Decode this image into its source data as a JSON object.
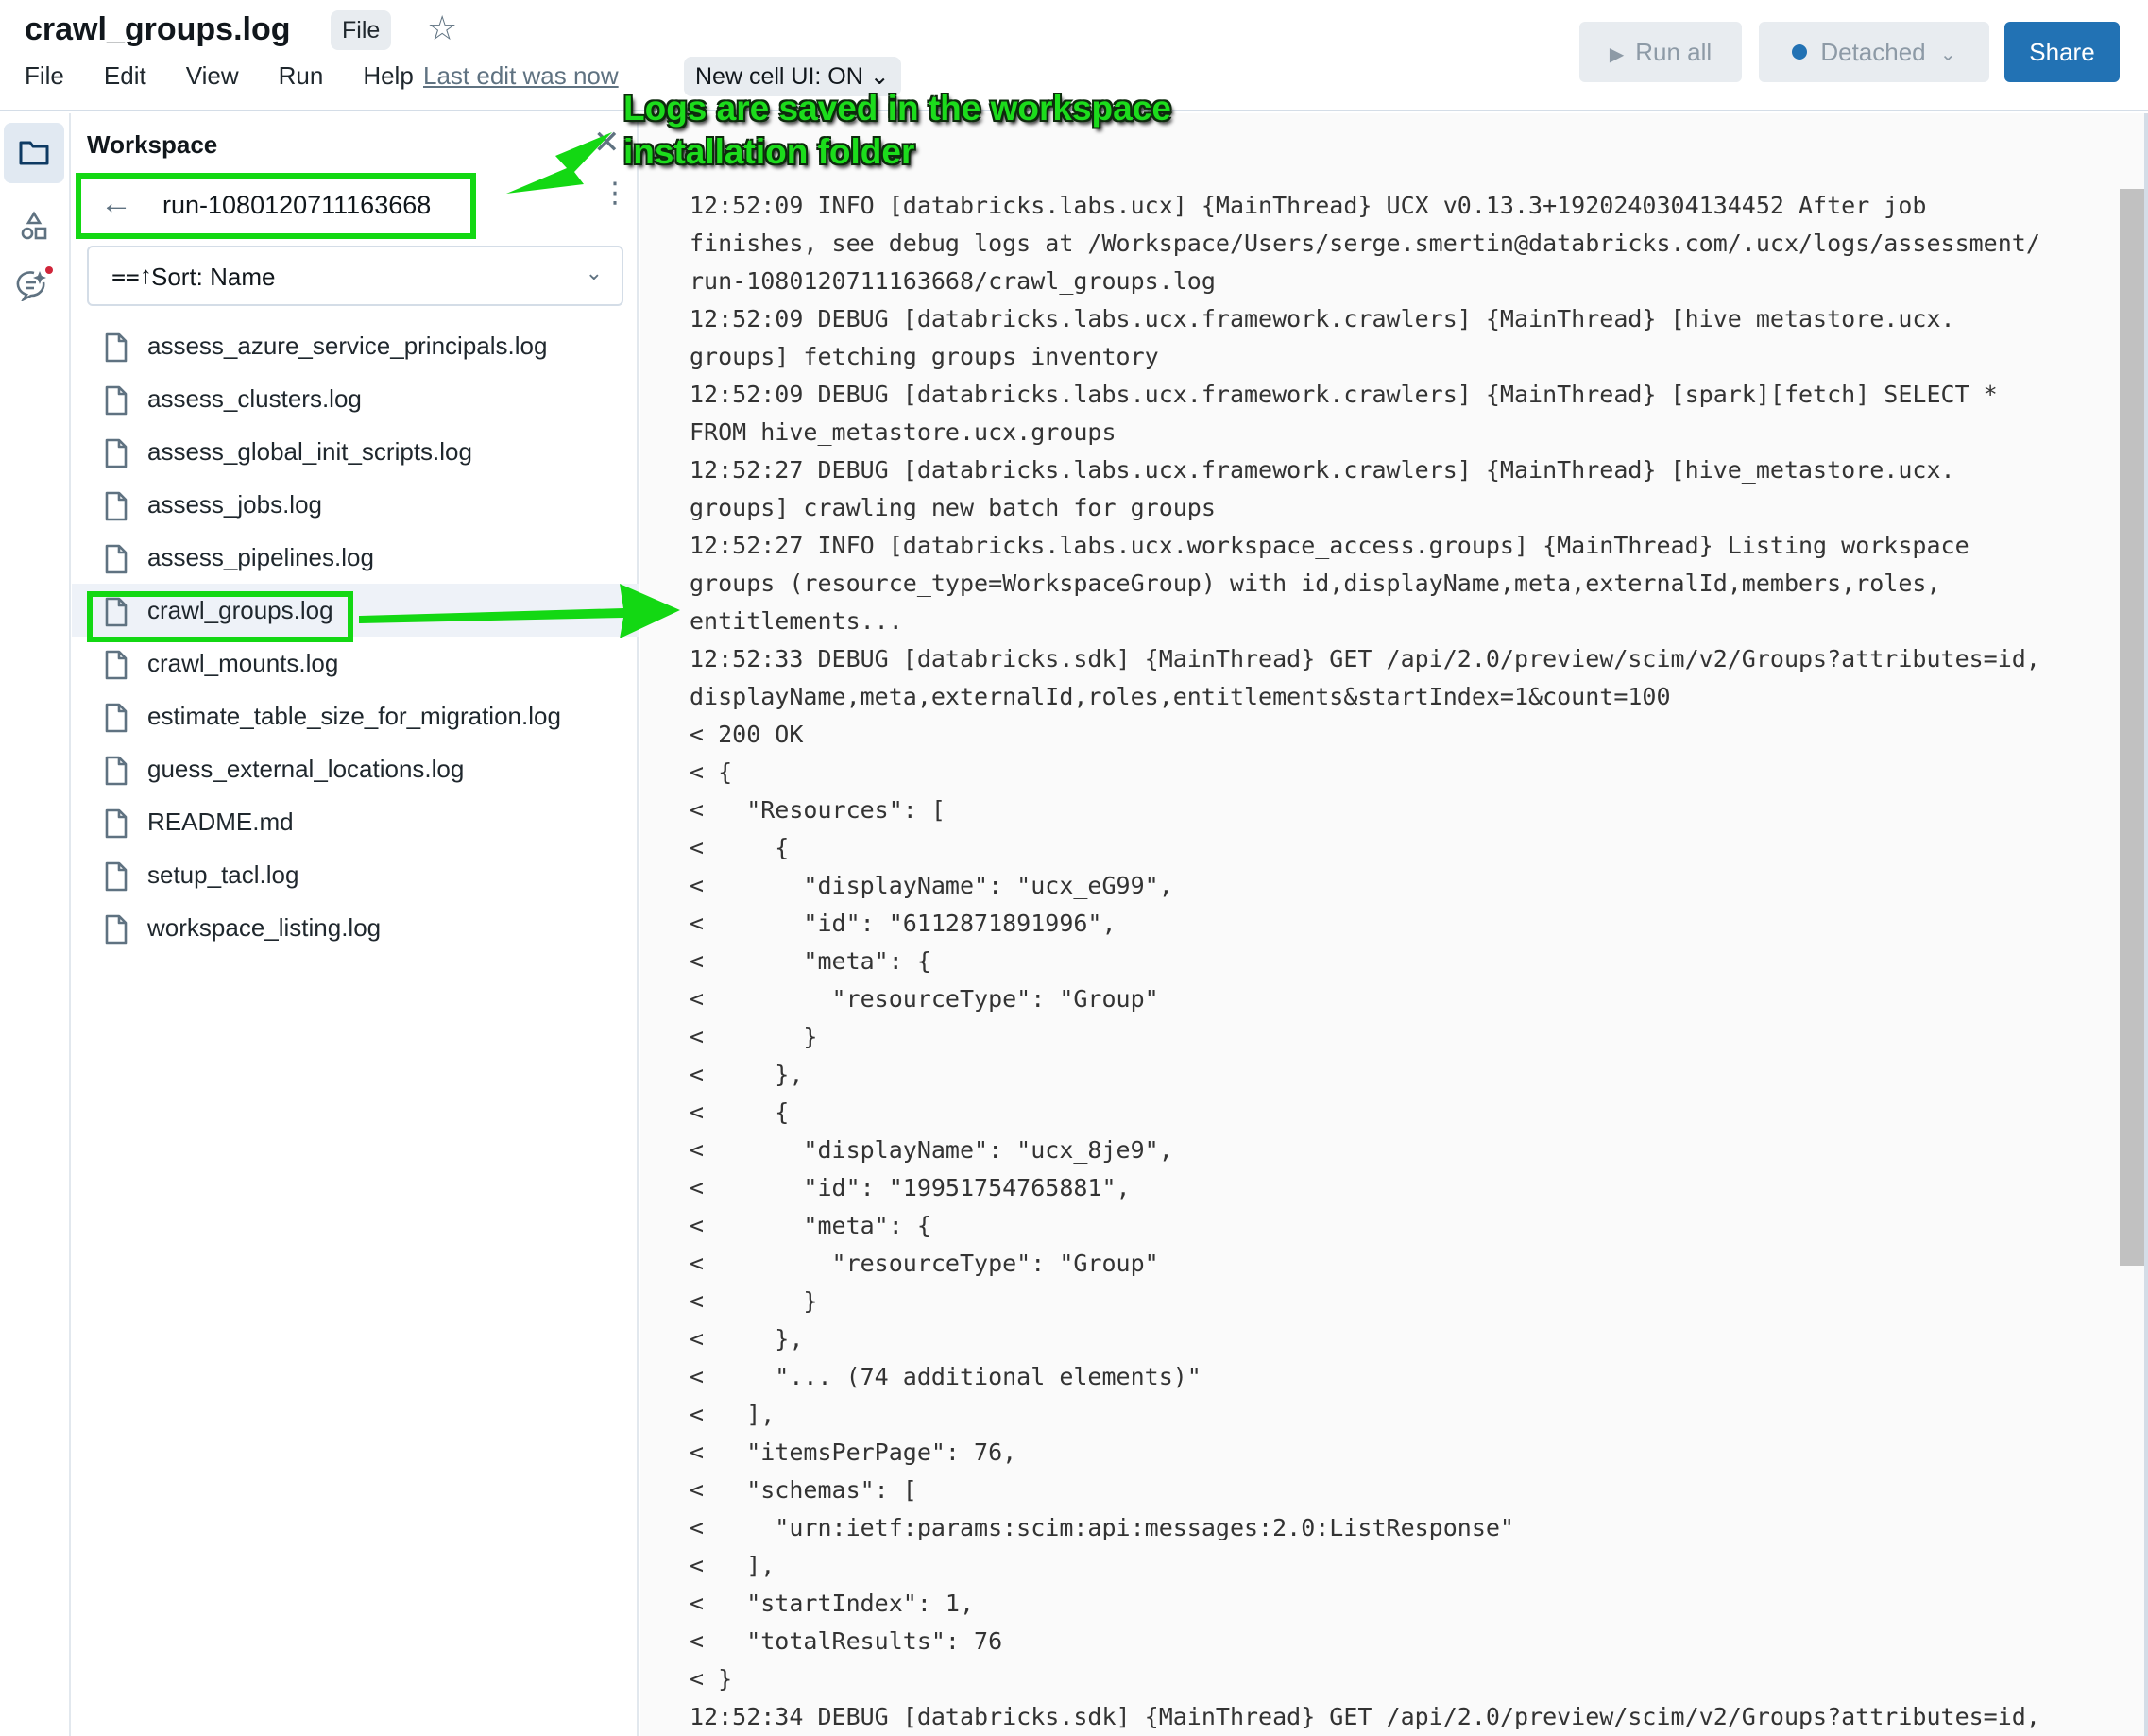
{
  "header": {
    "title": "crawl_groups.log",
    "type_badge": "File",
    "star_icon": "star-icon",
    "menu": [
      "File",
      "Edit",
      "View",
      "Run",
      "Help"
    ],
    "last_edit": "Last edit was now",
    "new_cell_ui": "New cell UI: ON ⌄",
    "run_all": "Run all",
    "compute_status": "Detached",
    "share": "Share"
  },
  "colors": {
    "accent": "#2272b4",
    "annotation_green": "#13d813",
    "log_background": "#fafafa"
  },
  "rail": {
    "items": [
      "workspace-folder-icon",
      "shapes-icon",
      "assistant-chat-icon"
    ]
  },
  "sidebar": {
    "title": "Workspace",
    "folder": "run-1080120711163668",
    "sort_label": "Sort: Name",
    "files": [
      {
        "name": "assess_azure_service_principals.log",
        "selected": false
      },
      {
        "name": "assess_clusters.log",
        "selected": false
      },
      {
        "name": "assess_global_init_scripts.log",
        "selected": false
      },
      {
        "name": "assess_jobs.log",
        "selected": false
      },
      {
        "name": "assess_pipelines.log",
        "selected": false
      },
      {
        "name": "crawl_groups.log",
        "selected": true
      },
      {
        "name": "crawl_mounts.log",
        "selected": false
      },
      {
        "name": "estimate_table_size_for_migration.log",
        "selected": false
      },
      {
        "name": "guess_external_locations.log",
        "selected": false
      },
      {
        "name": "README.md",
        "selected": false
      },
      {
        "name": "setup_tacl.log",
        "selected": false
      },
      {
        "name": "workspace_listing.log",
        "selected": false
      }
    ]
  },
  "annotation": {
    "text_line1": "Logs are saved in the workspace",
    "text_line2": "installation folder"
  },
  "log": {
    "lines": [
      "12:52:09 INFO [databricks.labs.ucx] {MainThread} UCX v0.13.3+1920240304134452 After job",
      "finishes, see debug logs at /Workspace/Users/serge.smertin@databricks.com/.ucx/logs/assessment/",
      "run-1080120711163668/crawl_groups.log",
      "12:52:09 DEBUG [databricks.labs.ucx.framework.crawlers] {MainThread} [hive_metastore.ucx.",
      "groups] fetching groups inventory",
      "12:52:09 DEBUG [databricks.labs.ucx.framework.crawlers] {MainThread} [spark][fetch] SELECT *",
      "FROM hive_metastore.ucx.groups",
      "12:52:27 DEBUG [databricks.labs.ucx.framework.crawlers] {MainThread} [hive_metastore.ucx.",
      "groups] crawling new batch for groups",
      "12:52:27 INFO [databricks.labs.ucx.workspace_access.groups] {MainThread} Listing workspace",
      "groups (resource_type=WorkspaceGroup) with id,displayName,meta,externalId,members,roles,",
      "entitlements...",
      "12:52:33 DEBUG [databricks.sdk] {MainThread} GET /api/2.0/preview/scim/v2/Groups?attributes=id,",
      "displayName,meta,externalId,roles,entitlements&startIndex=1&count=100",
      "< 200 OK",
      "< {",
      "<   \"Resources\": [",
      "<     {",
      "<       \"displayName\": \"ucx_eG99\",",
      "<       \"id\": \"6112871891996\",",
      "<       \"meta\": {",
      "<         \"resourceType\": \"Group\"",
      "<       }",
      "<     },",
      "<     {",
      "<       \"displayName\": \"ucx_8je9\",",
      "<       \"id\": \"19951754765881\",",
      "<       \"meta\": {",
      "<         \"resourceType\": \"Group\"",
      "<       }",
      "<     },",
      "<     \"... (74 additional elements)\"",
      "<   ],",
      "<   \"itemsPerPage\": 76,",
      "<   \"schemas\": [",
      "<     \"urn:ietf:params:scim:api:messages:2.0:ListResponse\"",
      "<   ],",
      "<   \"startIndex\": 1,",
      "<   \"totalResults\": 76",
      "< }",
      "12:52:34 DEBUG [databricks.sdk] {MainThread} GET /api/2.0/preview/scim/v2/Groups?attributes=id,"
    ]
  }
}
